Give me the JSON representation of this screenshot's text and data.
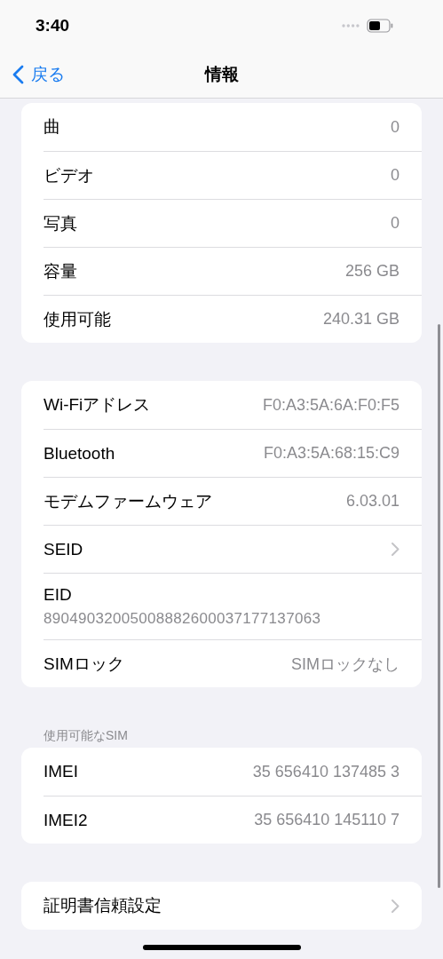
{
  "status_bar": {
    "time": "3:40"
  },
  "nav": {
    "back": "戻る",
    "title": "情報"
  },
  "groups": [
    {
      "rows": [
        {
          "kind": "value",
          "label": "曲",
          "value": "0"
        },
        {
          "kind": "value",
          "label": "ビデオ",
          "value": "0"
        },
        {
          "kind": "value",
          "label": "写真",
          "value": "0"
        },
        {
          "kind": "value",
          "label": "容量",
          "value": "256 GB"
        },
        {
          "kind": "value",
          "label": "使用可能",
          "value": "240.31 GB"
        }
      ]
    },
    {
      "rows": [
        {
          "kind": "value",
          "label": "Wi-Fiアドレス",
          "value": "F0:A3:5A:6A:F0:F5"
        },
        {
          "kind": "value",
          "label": "Bluetooth",
          "value": "F0:A3:5A:68:15:C9"
        },
        {
          "kind": "value",
          "label": "モデムファームウェア",
          "value": "6.03.01"
        },
        {
          "kind": "chevron",
          "label": "SEID"
        },
        {
          "kind": "stacked",
          "label": "EID",
          "value": "89049032005008882600037177137063"
        },
        {
          "kind": "value",
          "label": "SIMロック",
          "value": "SIMロックなし"
        }
      ]
    },
    {
      "header": "使用可能なSIM",
      "rows": [
        {
          "kind": "value",
          "label": "IMEI",
          "value": "35 656410 137485 3"
        },
        {
          "kind": "value",
          "label": "IMEI2",
          "value": "35 656410 145110 7"
        }
      ]
    },
    {
      "rows": [
        {
          "kind": "chevron",
          "label": "証明書信頼設定"
        }
      ]
    }
  ]
}
